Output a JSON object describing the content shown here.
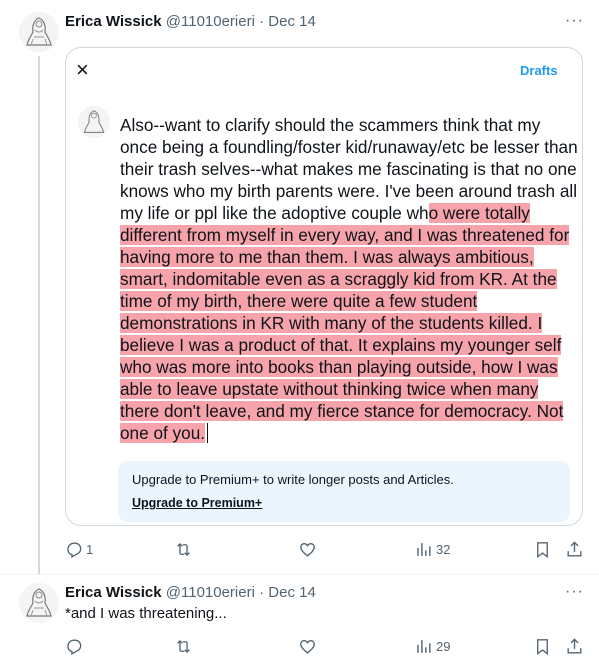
{
  "tweet1": {
    "name": "Erica Wissick",
    "handle": "@11010erieri",
    "dot": "·",
    "date": "Dec 14",
    "more": "···",
    "card": {
      "close": "×",
      "drafts": "Drafts",
      "text_plain": "Also--want to clarify should the scammers think that my once being a foundling/foster kid/runaway/etc be lesser than their trash selves--what makes me fascinating is that no one knows who my birth parents were. I've been around trash all my life or ppl like the adoptive couple wh",
      "text_highlighted": "o were totally different from myself in every way, and I was threatened for having more to me than them. I was always ambitious, smart, indomitable even as a scraggly kid from KR. At the time of my birth, there were quite a few student demonstrations in KR with many of the students killed. I believe I was a product of that. It explains my younger self who was more into books than playing outside, how I was able to leave upstate without thinking twice when many there don't leave, and my fierce stance for democracy. Not one of you.",
      "premium_message": "Upgrade to Premium+ to write longer posts and Articles.",
      "premium_link": "Upgrade to Premium+"
    },
    "actions": {
      "reply_count": "1",
      "retweet_count": "",
      "like_count": "",
      "views_count": "32"
    }
  },
  "tweet2": {
    "name": "Erica Wissick",
    "handle": "@11010erieri",
    "dot": "·",
    "date": "Dec 14",
    "more": "···",
    "text": "*and I was threatening...",
    "actions": {
      "reply_count": "",
      "retweet_count": "",
      "like_count": "",
      "views_count": "29"
    }
  },
  "colors": {
    "accent": "#1d9bf0",
    "highlight": "#f7a3ab",
    "muted": "#536471",
    "premium_bg": "#eaf5fd"
  },
  "icons": [
    "avatar-sketch",
    "close-icon",
    "reply-icon",
    "retweet-icon",
    "like-icon",
    "views-icon",
    "bookmark-icon",
    "share-icon",
    "more-icon"
  ]
}
